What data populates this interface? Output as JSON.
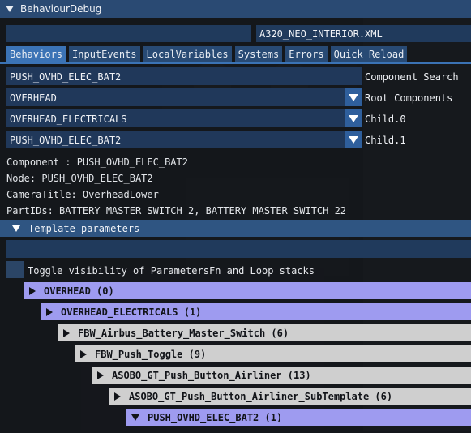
{
  "window": {
    "title": "BehaviourDebug"
  },
  "file": {
    "name": "A320_NEO_INTERIOR.XML"
  },
  "tabs": [
    "Behaviors",
    "InputEvents",
    "LocalVariables",
    "Systems",
    "Errors",
    "Quick Reload"
  ],
  "component_search": {
    "value": "PUSH_OVHD_ELEC_BAT2",
    "label": "Component Search"
  },
  "root_components": {
    "value": "OVERHEAD",
    "label": "Root Components"
  },
  "child0": {
    "value": "OVERHEAD_ELECTRICALS",
    "label": "Child.0"
  },
  "child1": {
    "value": "PUSH_OVHD_ELEC_BAT2",
    "label": "Child.1"
  },
  "info": {
    "component": "Component : PUSH_OVHD_ELEC_BAT2",
    "node": "Node: PUSH_OVHD_ELEC_BAT2",
    "camera": "CameraTitle: OverheadLower",
    "parts": "PartIDs: BATTERY_MASTER_SWITCH_2, BATTERY_MASTER_SWITCH_22"
  },
  "template": {
    "header": "Template parameters"
  },
  "toggle": {
    "label": "Toggle visibility of ParametersFn and Loop stacks"
  },
  "tree": [
    {
      "label": "OVERHEAD (0)",
      "color": "#9e9bf0",
      "icon": "arrow-right-icon"
    },
    {
      "label": "OVERHEAD_ELECTRICALS (1)",
      "color": "#9e9bf0",
      "icon": "arrow-right-icon"
    },
    {
      "label": "FBW_Airbus_Battery_Master_Switch (6)",
      "color": "#cfcfcf",
      "icon": "arrow-right-icon"
    },
    {
      "label": "FBW_Push_Toggle (9)",
      "color": "#cfcfcf",
      "icon": "arrow-right-icon"
    },
    {
      "label": "ASOBO_GT_Push_Button_Airliner (13)",
      "color": "#cfcfcf",
      "icon": "arrow-right-icon"
    },
    {
      "label": "ASOBO_GT_Push_Button_Airliner_SubTemplate (6)",
      "color": "#cfcfcf",
      "icon": "arrow-right-icon"
    },
    {
      "label": "PUSH_OVHD_ELEC_BAT2 (1)",
      "color": "#9e9bf0",
      "icon": "arrow-down-icon"
    }
  ]
}
